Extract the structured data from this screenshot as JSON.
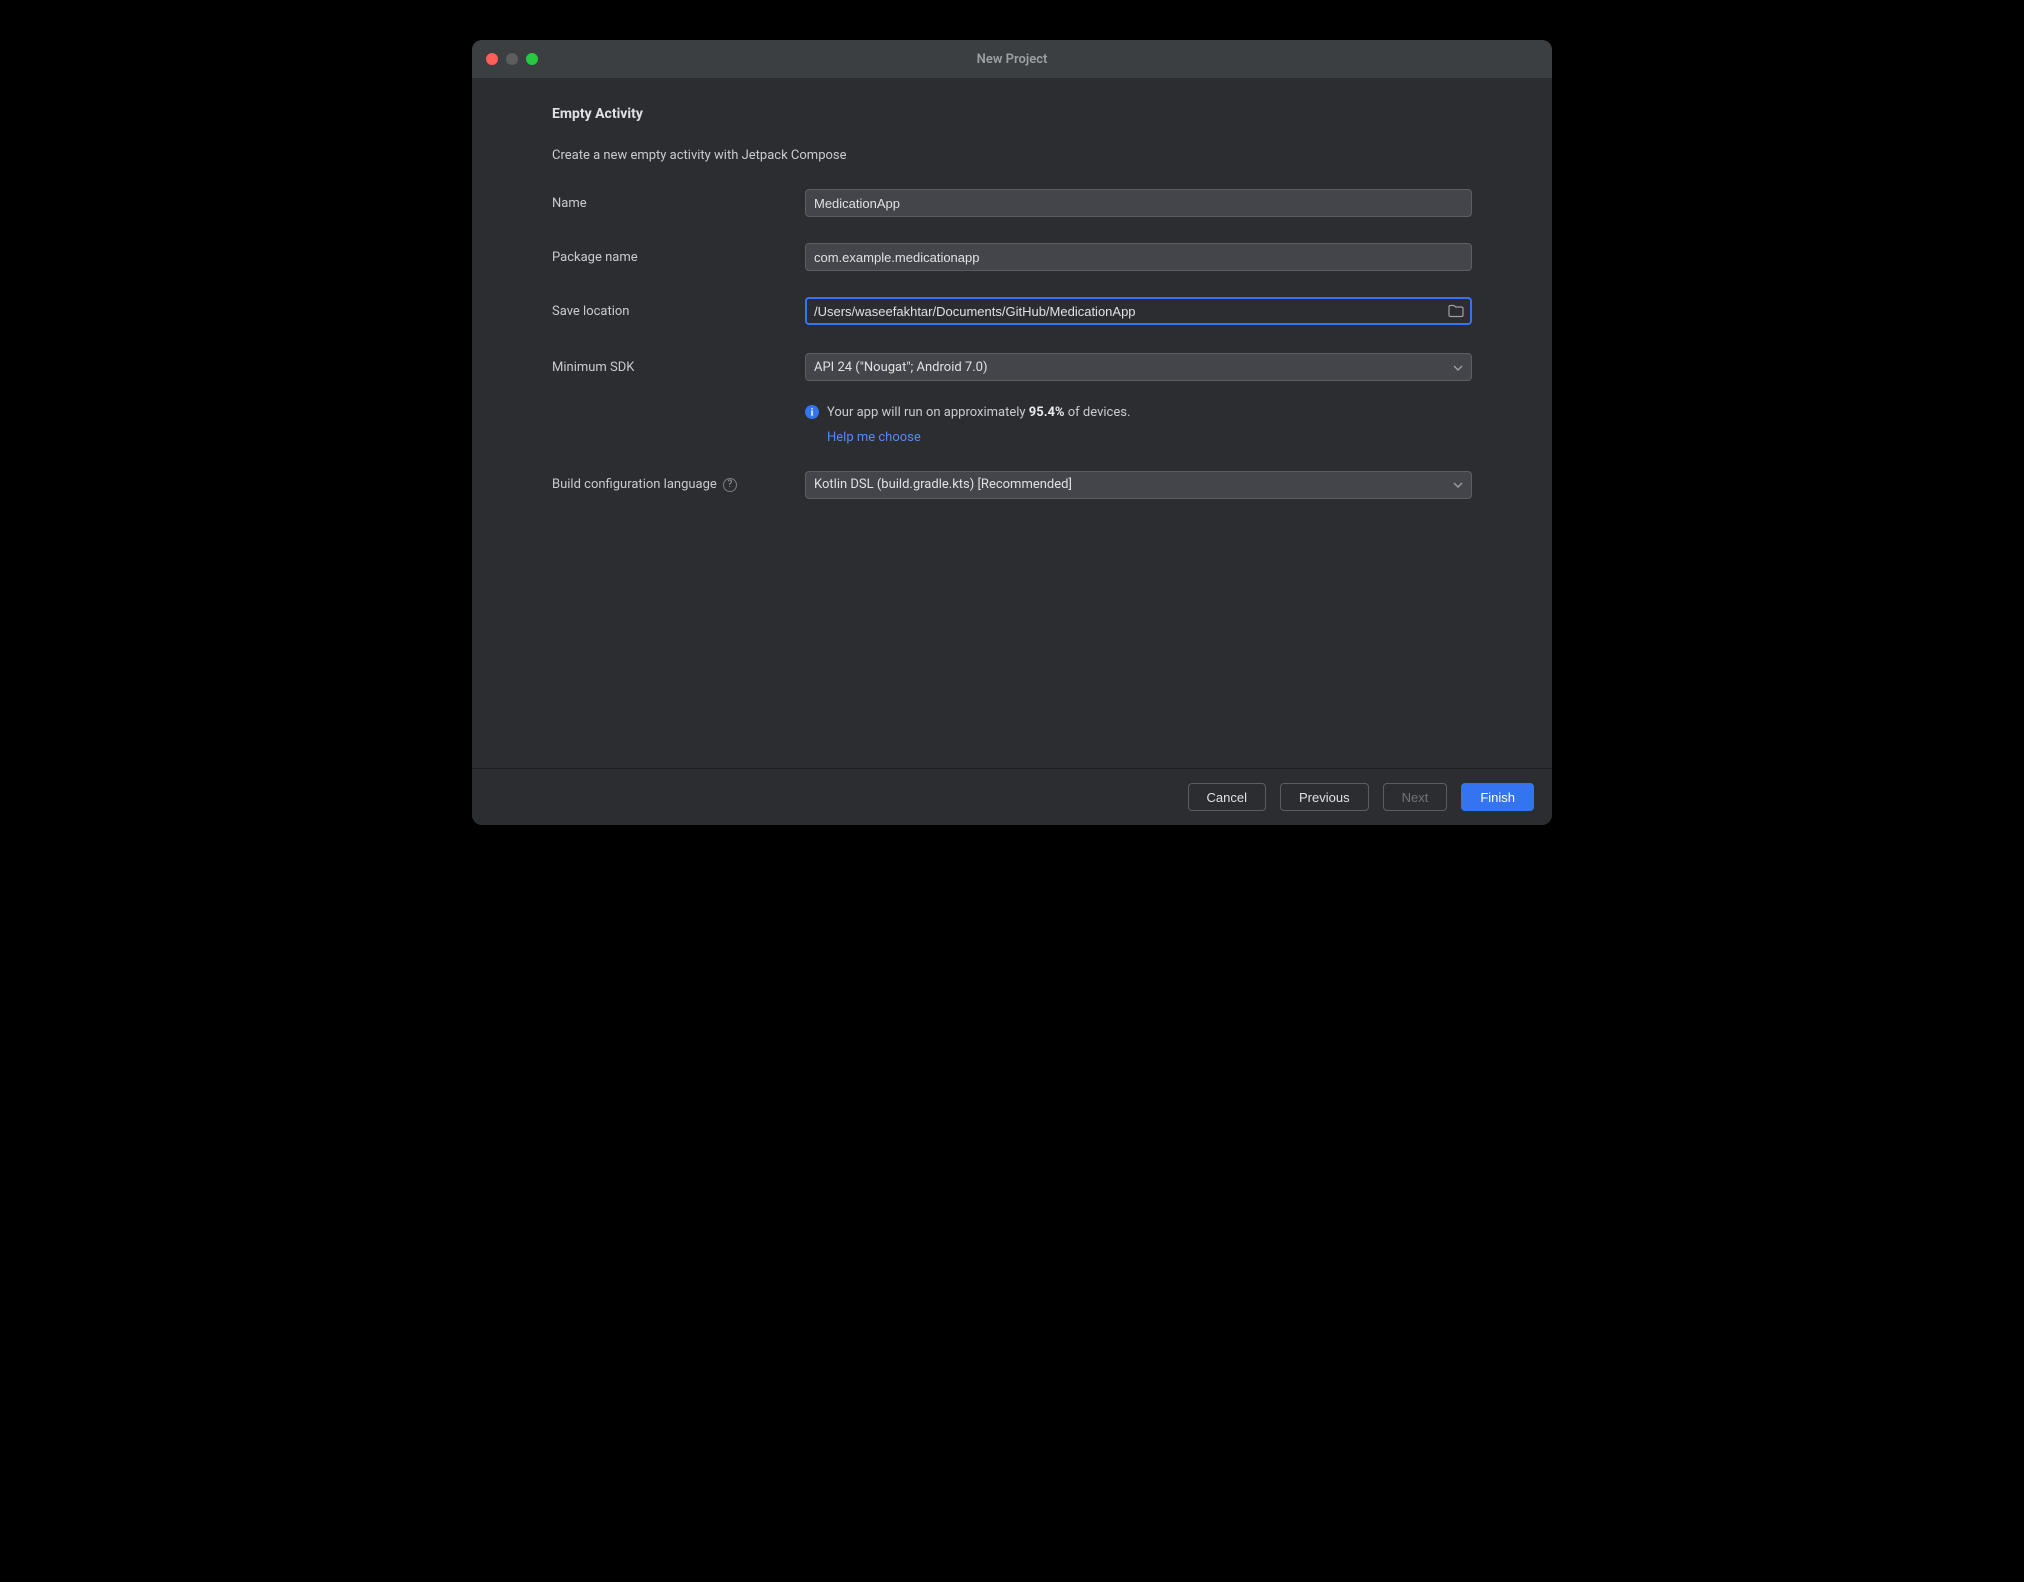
{
  "window": {
    "title": "New Project"
  },
  "page": {
    "heading": "Empty Activity",
    "description": "Create a new empty activity with Jetpack Compose"
  },
  "form": {
    "name": {
      "label": "Name",
      "value": "MedicationApp"
    },
    "package": {
      "label": "Package name",
      "value": "com.example.medicationapp"
    },
    "save_location": {
      "label": "Save location",
      "value": "/Users/waseefakhtar/Documents/GitHub/MedicationApp"
    },
    "min_sdk": {
      "label": "Minimum SDK",
      "value": "API 24 (\"Nougat\"; Android 7.0)"
    },
    "build_lang": {
      "label": "Build configuration language",
      "value": "Kotlin DSL (build.gradle.kts) [Recommended]"
    }
  },
  "info": {
    "prefix": "Your app will run on approximately ",
    "percent": "95.4%",
    "suffix": " of devices.",
    "help_link": "Help me choose"
  },
  "buttons": {
    "cancel": "Cancel",
    "previous": "Previous",
    "next": "Next",
    "finish": "Finish"
  }
}
